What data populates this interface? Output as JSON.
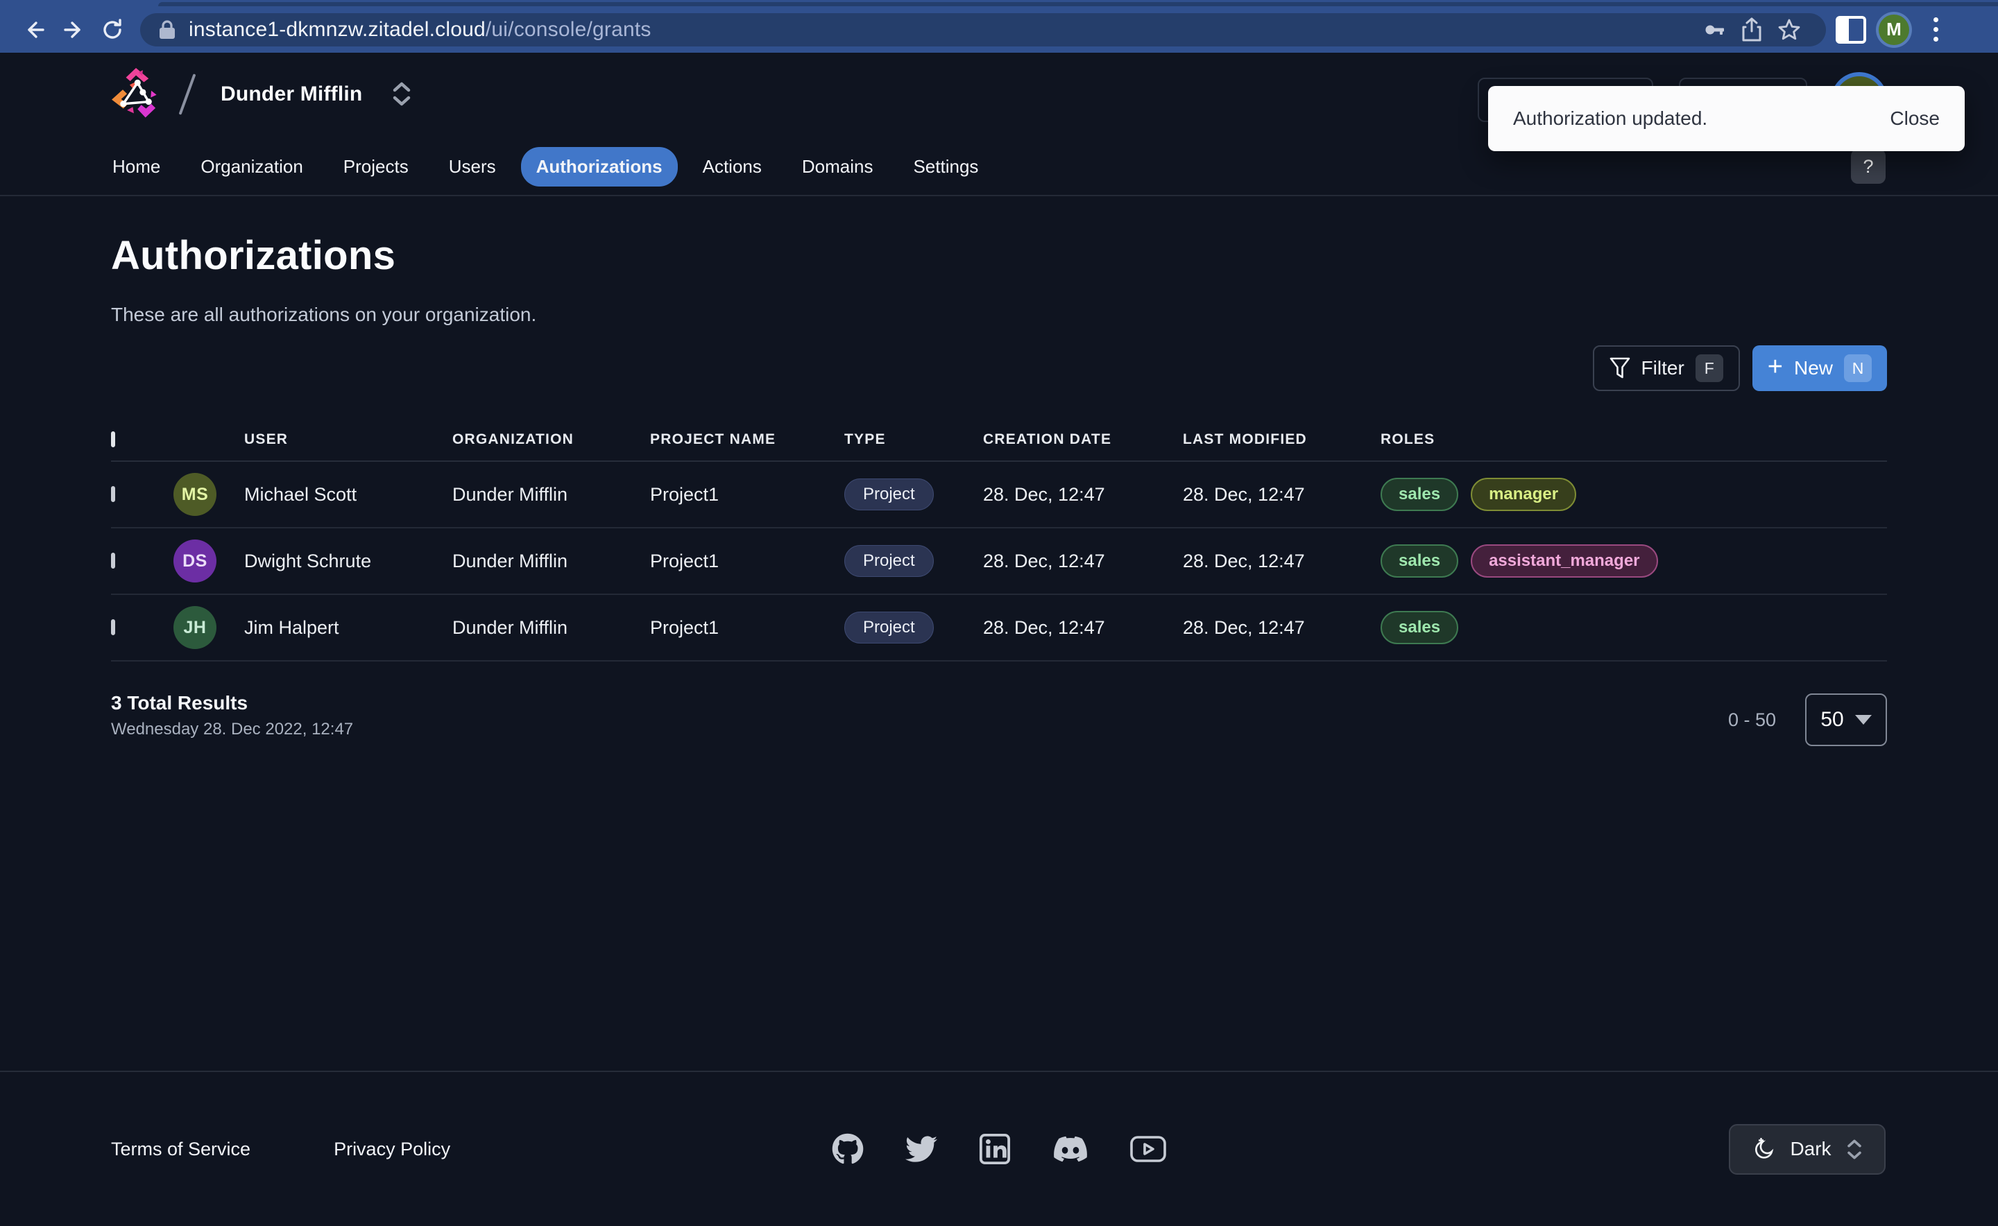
{
  "browser": {
    "url_host": "instance1-dkmnzw.zitadel.cloud",
    "url_path": "/ui/console/grants",
    "avatar_initial": "M"
  },
  "header": {
    "org_name": "Dunder Mifflin",
    "help_label": "?"
  },
  "toast": {
    "message": "Authorization updated.",
    "close_label": "Close"
  },
  "nav": {
    "items": [
      {
        "label": "Home",
        "active": false
      },
      {
        "label": "Organization",
        "active": false
      },
      {
        "label": "Projects",
        "active": false
      },
      {
        "label": "Users",
        "active": false
      },
      {
        "label": "Authorizations",
        "active": true
      },
      {
        "label": "Actions",
        "active": false
      },
      {
        "label": "Domains",
        "active": false
      },
      {
        "label": "Settings",
        "active": false
      }
    ],
    "active_color": "#4177c9"
  },
  "page": {
    "title": "Authorizations",
    "description": "These are all authorizations on your organization.",
    "filter_label": "Filter",
    "filter_shortcut": "F",
    "new_label": "New",
    "new_shortcut": "N",
    "new_button_color": "#4583d6"
  },
  "table": {
    "columns": [
      "USER",
      "ORGANIZATION",
      "PROJECT NAME",
      "TYPE",
      "CREATION DATE",
      "LAST MODIFIED",
      "ROLES"
    ],
    "rows": [
      {
        "initials": "MS",
        "avatar_bg": "#4e5b26",
        "avatar_fg": "#e3f4a4",
        "user": "Michael Scott",
        "organization": "Dunder Mifflin",
        "project": "Project1",
        "type": "Project",
        "creation_date": "28. Dec, 12:47",
        "last_modified": "28. Dec, 12:47",
        "roles": [
          {
            "label": "sales",
            "variant": "green"
          },
          {
            "label": "manager",
            "variant": "olive"
          }
        ]
      },
      {
        "initials": "DS",
        "avatar_bg": "#6c2ea4",
        "avatar_fg": "#ebddf8",
        "user": "Dwight Schrute",
        "organization": "Dunder Mifflin",
        "project": "Project1",
        "type": "Project",
        "creation_date": "28. Dec, 12:47",
        "last_modified": "28. Dec, 12:47",
        "roles": [
          {
            "label": "sales",
            "variant": "green"
          },
          {
            "label": "assistant_manager",
            "variant": "pink"
          }
        ]
      },
      {
        "initials": "JH",
        "avatar_bg": "#2c5a3c",
        "avatar_fg": "#c9ebd6",
        "user": "Jim Halpert",
        "organization": "Dunder Mifflin",
        "project": "Project1",
        "type": "Project",
        "creation_date": "28. Dec, 12:47",
        "last_modified": "28. Dec, 12:47",
        "roles": [
          {
            "label": "sales",
            "variant": "green"
          }
        ]
      }
    ],
    "role_colors": {
      "green": "#9fe7ae",
      "olive": "#d9ef85",
      "pink": "#f1a9da"
    }
  },
  "pagination": {
    "total": "3 Total Results",
    "timestamp": "Wednesday 28. Dec 2022, 12:47",
    "range": "0 - 50",
    "page_size": "50"
  },
  "footer": {
    "links": [
      "Terms of Service",
      "Privacy Policy"
    ],
    "social_icons": [
      "github-icon",
      "twitter-icon",
      "linkedin-icon",
      "discord-icon",
      "youtube-icon"
    ],
    "theme_label": "Dark"
  }
}
